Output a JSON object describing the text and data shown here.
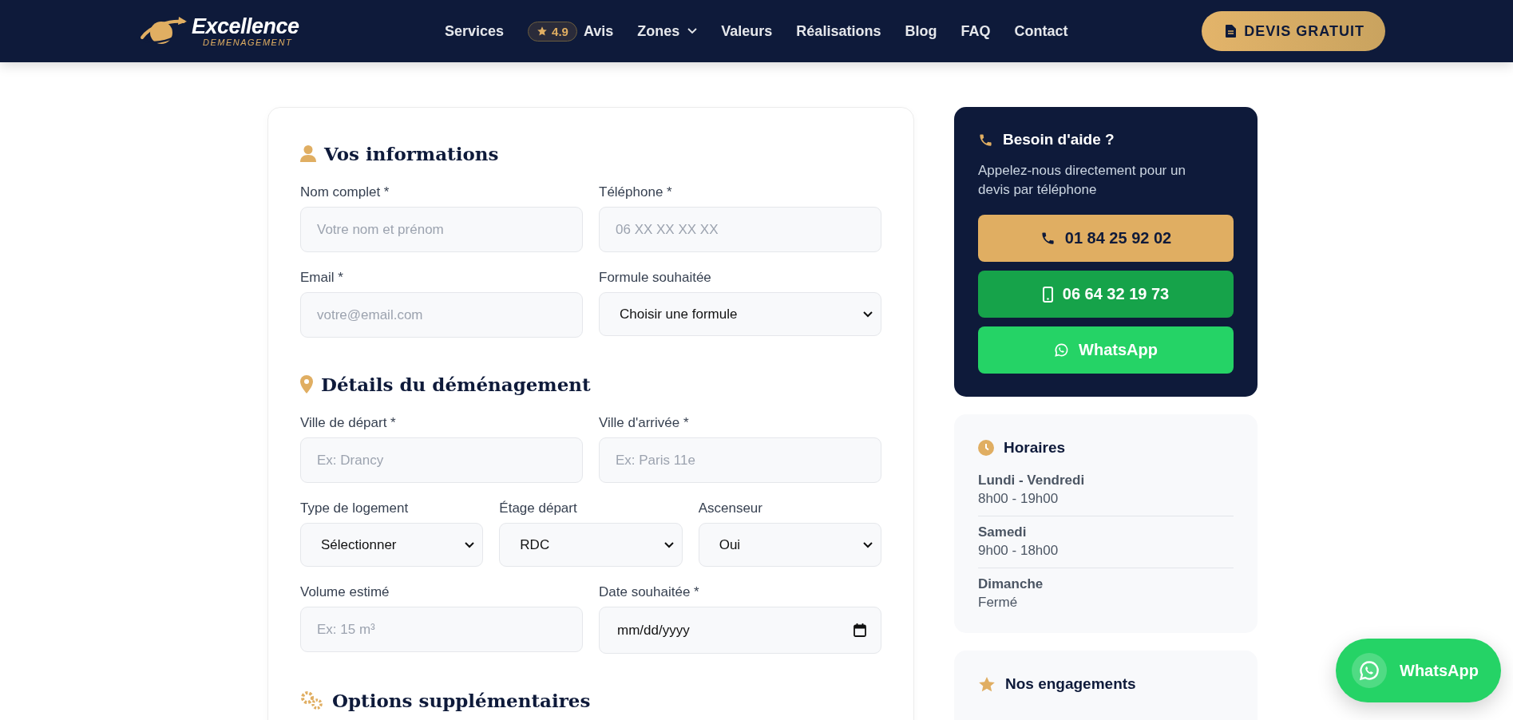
{
  "header": {
    "logo": {
      "name": "Excellence",
      "tagline": "DEMENAGEMENT"
    },
    "nav": [
      {
        "kind": "link",
        "label": "Services"
      },
      {
        "kind": "rating",
        "rating": "4.9",
        "label": "Avis"
      },
      {
        "kind": "dropdown",
        "label": "Zones"
      },
      {
        "kind": "link",
        "label": "Valeurs"
      },
      {
        "kind": "link",
        "label": "Réalisations"
      },
      {
        "kind": "link",
        "label": "Blog"
      },
      {
        "kind": "link",
        "label": "FAQ"
      },
      {
        "kind": "link",
        "label": "Contact"
      }
    ],
    "cta": "DEVIS GRATUIT"
  },
  "form": {
    "sections": [
      {
        "title": "Vos informations",
        "rows": [
          [
            {
              "kind": "text",
              "label": "Nom complet *",
              "placeholder": "Votre nom et prénom"
            },
            {
              "kind": "text",
              "label": "Téléphone *",
              "placeholder": "06 XX XX XX XX"
            }
          ],
          [
            {
              "kind": "text",
              "label": "Email *",
              "placeholder": "votre@email.com"
            },
            {
              "kind": "select",
              "label": "Formule souhaitée",
              "value": "Choisir une formule"
            }
          ]
        ]
      },
      {
        "title": "Détails du déménagement",
        "rows": [
          [
            {
              "kind": "text",
              "label": "Ville de départ *",
              "placeholder": "Ex: Drancy"
            },
            {
              "kind": "text",
              "label": "Ville d'arrivée *",
              "placeholder": "Ex: Paris 11e"
            }
          ],
          [
            {
              "kind": "select",
              "label": "Type de logement",
              "value": "Sélectionner"
            },
            {
              "kind": "select",
              "label": "Étage départ",
              "value": "RDC"
            },
            {
              "kind": "select",
              "label": "Ascenseur",
              "value": "Oui"
            }
          ],
          [
            {
              "kind": "text",
              "label": "Volume estimé",
              "placeholder": "Ex: 15 m³"
            },
            {
              "kind": "date",
              "label": "Date souhaitée *",
              "value": "mm/dd/yyyy"
            }
          ]
        ]
      },
      {
        "title": "Options supplémentaires"
      }
    ]
  },
  "help": {
    "title": "Besoin d'aide ?",
    "text": "Appelez-nous directement pour un devis par téléphone",
    "buttons": [
      {
        "kind": "phone",
        "label": "01 84 25 92 02"
      },
      {
        "kind": "mobile",
        "label": "06 64 32 19 73"
      },
      {
        "kind": "whatsapp",
        "label": "WhatsApp"
      }
    ]
  },
  "hours": {
    "title": "Horaires",
    "entries": [
      {
        "day": "Lundi - Vendredi",
        "time": "8h00 - 19h00"
      },
      {
        "day": "Samedi",
        "time": "9h00 - 18h00"
      },
      {
        "day": "Dimanche",
        "time": "Fermé"
      }
    ]
  },
  "engagements": {
    "title": "Nos engagements"
  },
  "floating_button": {
    "label": "WhatsApp"
  }
}
